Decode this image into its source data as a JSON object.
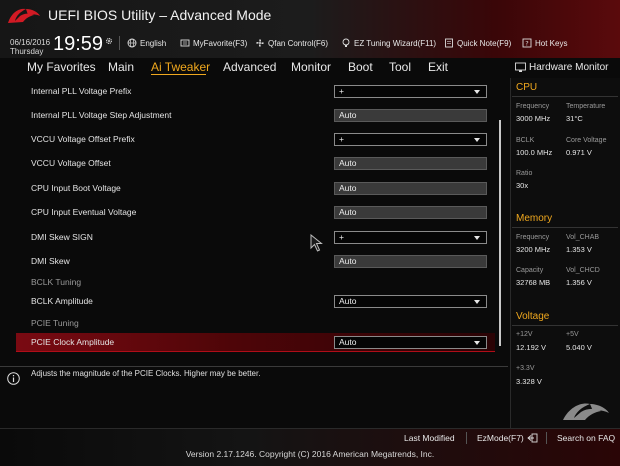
{
  "header": {
    "title": "UEFI BIOS Utility – Advanced Mode",
    "date": "06/16/2016",
    "day": "Thursday",
    "time": "19:59",
    "buttons": [
      "English",
      "MyFavorite(F3)",
      "Qfan Control(F6)",
      "EZ Tuning Wizard(F11)",
      "Quick Note(F9)",
      "Hot Keys"
    ]
  },
  "menu": {
    "items": [
      "My Favorites",
      "Main",
      "Ai Tweaker",
      "Advanced",
      "Monitor",
      "Boot",
      "Tool",
      "Exit"
    ],
    "active": "Ai Tweaker"
  },
  "settings": [
    {
      "label": "Internal PLL Voltage Prefix",
      "value": "+",
      "type": "dropdown"
    },
    {
      "label": "Internal PLL Voltage Step Adjustment",
      "value": "Auto",
      "type": "field"
    },
    {
      "label": "VCCU Voltage Offset Prefix",
      "value": "+",
      "type": "dropdown"
    },
    {
      "label": "VCCU Voltage Offset",
      "value": "Auto",
      "type": "field"
    },
    {
      "label": "CPU Input Boot Voltage",
      "value": "Auto",
      "type": "field"
    },
    {
      "label": "CPU Input Eventual Voltage",
      "value": "Auto",
      "type": "field"
    },
    {
      "label": "DMI Skew SIGN",
      "value": "+",
      "type": "dropdown"
    },
    {
      "label": "DMI Skew",
      "value": "Auto",
      "type": "field"
    },
    {
      "label": "BCLK Tuning",
      "type": "subheader"
    },
    {
      "label": "BCLK Amplitude",
      "value": "Auto",
      "type": "dropdown"
    },
    {
      "label": "PCIE Tuning",
      "type": "subheader"
    },
    {
      "label": "PCIE Clock Amplitude",
      "value": "Auto",
      "type": "dropdown",
      "selected": true
    }
  ],
  "info": {
    "text": "Adjusts the magnitude of the PCIE Clocks. Higher may be better."
  },
  "monitor": {
    "title": "Hardware Monitor",
    "cpu": {
      "heading": "CPU",
      "frequency_label": "Frequency",
      "frequency": "3000 MHz",
      "temperature_label": "Temperature",
      "temperature": "31°C",
      "bclk_label": "BCLK",
      "bclk": "100.0 MHz",
      "core_voltage_label": "Core Voltage",
      "core_voltage": "0.971 V",
      "ratio_label": "Ratio",
      "ratio": "30x"
    },
    "memory": {
      "heading": "Memory",
      "frequency_label": "Frequency",
      "frequency": "3200 MHz",
      "vol_chab_label": "Vol_CHAB",
      "vol_chab": "1.353 V",
      "capacity_label": "Capacity",
      "capacity": "32768 MB",
      "vol_chcd_label": "Vol_CHCD",
      "vol_chcd": "1.356 V"
    },
    "voltage": {
      "heading": "Voltage",
      "v12_label": "+12V",
      "v12": "12.192 V",
      "v5_label": "+5V",
      "v5": "5.040 V",
      "v33_label": "+3.3V",
      "v33": "3.328 V"
    }
  },
  "footer": {
    "last_modified": "Last Modified",
    "ezmode": "EzMode(F7)",
    "search": "Search on FAQ",
    "version": "Version 2.17.1246. Copyright (C) 2016 American Megatrends, Inc."
  },
  "colors": {
    "accent": "#f0a81e",
    "selection": "#7a0a12"
  }
}
